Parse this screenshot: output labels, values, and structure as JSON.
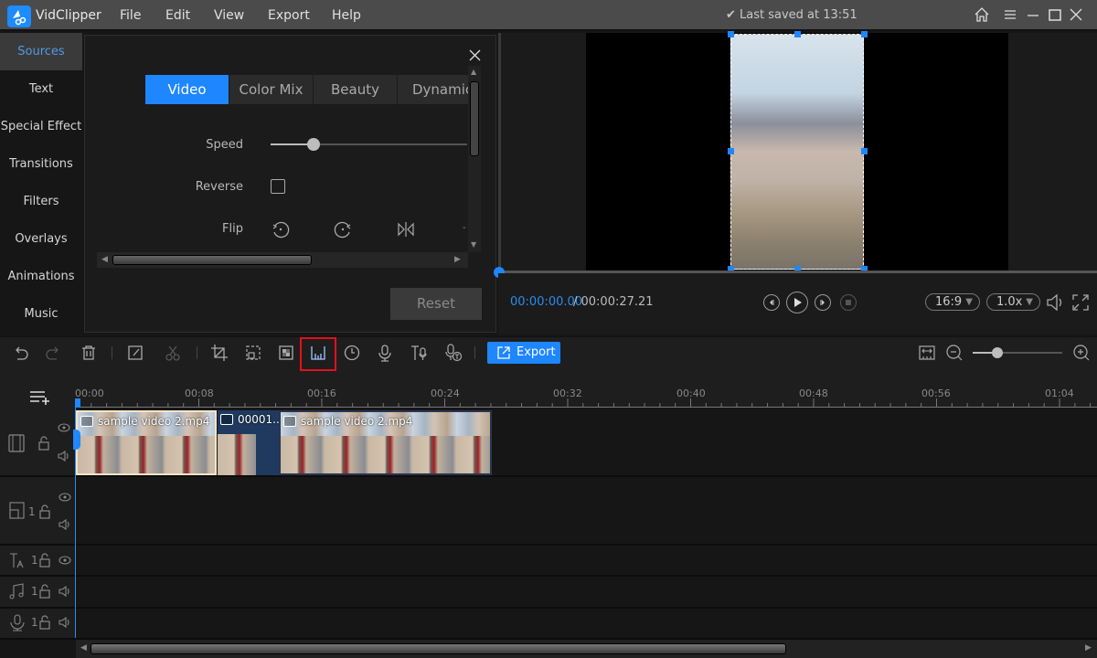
{
  "app": {
    "name": "VidClipper",
    "last_saved": "Last saved at 13:51"
  },
  "menu": [
    "File",
    "Edit",
    "View",
    "Export",
    "Help"
  ],
  "colors": {
    "accent": "#1e86ff",
    "highlight": "#e3101c",
    "bg": "#161616"
  },
  "sidebar": {
    "items": [
      {
        "label": "Sources",
        "active": true
      },
      {
        "label": "Text"
      },
      {
        "label": "Special Effect"
      },
      {
        "label": "Transitions"
      },
      {
        "label": "Filters"
      },
      {
        "label": "Overlays"
      },
      {
        "label": "Animations"
      },
      {
        "label": "Music"
      }
    ]
  },
  "panel": {
    "tabs": [
      {
        "label": "Video",
        "active": true
      },
      {
        "label": "Color Mix"
      },
      {
        "label": "Beauty"
      },
      {
        "label": "Dynamic"
      }
    ],
    "speed_label": "Speed",
    "speed_value_fraction": 0.22,
    "reverse_label": "Reverse",
    "reverse_checked": false,
    "flip_label": "Flip",
    "flip_icons": [
      "rotate-left-icon",
      "rotate-right-icon",
      "flip-horizontal-icon"
    ],
    "reset_label": "Reset"
  },
  "player": {
    "current_time": "00:00:00.00",
    "total_time": "/ 00:00:27.21",
    "aspect_ratio": "16:9",
    "speed": "1.0x",
    "progress_fraction": 0.0
  },
  "toolbar": {
    "export_label": "Export",
    "highlighted_tool": "mosaic-icon",
    "zoom_fraction": 0.28
  },
  "timeline": {
    "ruler_labels": [
      "00:00",
      "00:08",
      "00:16",
      "00:24",
      "00:32",
      "00:40",
      "00:48",
      "00:56",
      "01:04"
    ],
    "clips": [
      {
        "label": "sample video 2.mp4",
        "type": "video",
        "selected": true
      },
      {
        "label": "00001...",
        "type": "image"
      },
      {
        "label": "sample video 2.mp4",
        "type": "video"
      }
    ],
    "tracks": [
      {
        "name": "video",
        "count": ""
      },
      {
        "name": "pip",
        "count": "1"
      },
      {
        "name": "text",
        "count": "1"
      },
      {
        "name": "music",
        "count": "1"
      },
      {
        "name": "voice",
        "count": "1"
      }
    ]
  }
}
